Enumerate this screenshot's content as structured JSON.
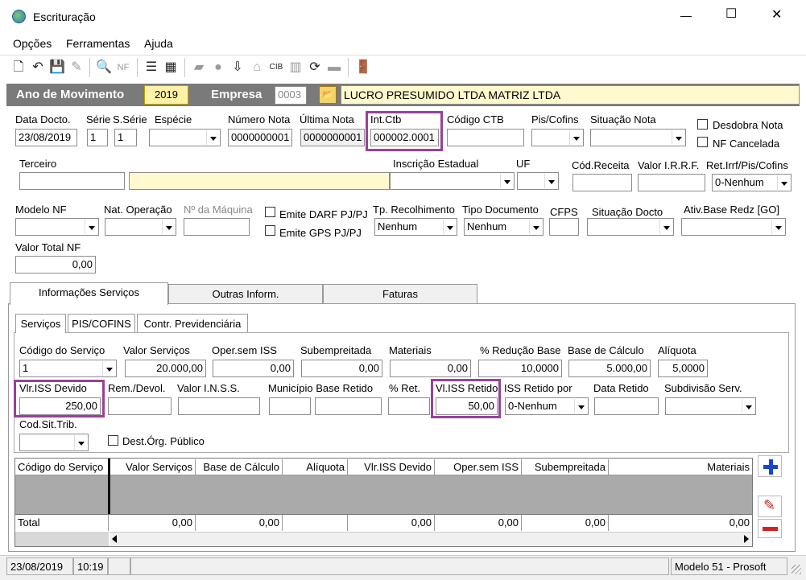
{
  "window": {
    "title": "Escrituração",
    "minimize": "—",
    "maximize": "☐",
    "close": "✕"
  },
  "menu": [
    "Opções",
    "Ferramentas",
    "Ajuda"
  ],
  "header": {
    "ano_label": "Ano de Movimento",
    "ano_value": "2019",
    "empresa_label": "Empresa",
    "empresa_code": "0003",
    "empresa_name": "LUCRO PRESUMIDO LTDA MATRIZ LTDA"
  },
  "row1": {
    "data_docto_label": "Data Docto.",
    "data_docto": "23/08/2019",
    "serie_label": "Série",
    "serie": "1",
    "sserie_label": "S.Série",
    "sserie": "1",
    "especie_label": "Espécie",
    "especie": "",
    "numero_nota_label": "Número Nota",
    "numero_nota": "0000000001",
    "ultima_nota_label": "Última Nota",
    "ultima_nota": "0000000001",
    "int_ctb_label": "Int.Ctb",
    "int_ctb": "000002.0001",
    "codigo_ctb_label": "Código CTB",
    "codigo_ctb": "",
    "pis_cofins_label": "Pis/Cofins",
    "pis_cofins": "",
    "situacao_nota_label": "Situação Nota",
    "situacao_nota": "",
    "desdobra_label": "Desdobra Nota",
    "nf_cancelada_label": "NF Cancelada"
  },
  "row2": {
    "terceiro_label": "Terceiro",
    "terceiro_code": "",
    "terceiro_name": "",
    "insc_estadual_label": "Inscrição Estadual",
    "insc_estadual": "",
    "uf_label": "UF",
    "uf": "",
    "cod_receita_label": "Cód.Receita",
    "cod_receita": "",
    "valor_irrf_label": "Valor I.R.R.F.",
    "valor_irrf": "",
    "ret_irrf_label": "Ret.Irrf/Pis/Cofins",
    "ret_irrf": "0-Nenhum"
  },
  "row3": {
    "modelo_nf_label": "Modelo NF",
    "modelo_nf": "",
    "nat_operacao_label": "Nat. Operação",
    "nat_operacao": "",
    "n_maquina_label": "Nº da Máquina",
    "n_maquina": "",
    "emite_darf_label": "Emite DARF PJ/PJ",
    "emite_gps_label": "Emite GPS PJ/PJ",
    "tp_recolhimento_label": "Tp. Recolhimento",
    "tp_recolhimento": "Nenhum",
    "tipo_documento_label": "Tipo Documento",
    "tipo_documento": "Nenhum",
    "cfps_label": "CFPS",
    "cfps": "",
    "situacao_docto_label": "Situação Docto",
    "situacao_docto": "",
    "ativ_base_label": "Ativ.Base Redz [GO]",
    "ativ_base": ""
  },
  "row4": {
    "valor_total_label": "Valor Total NF",
    "valor_total": "0,00"
  },
  "tabs": [
    "Informações Serviços",
    "Outras Inform.",
    "Faturas"
  ],
  "subtabs": [
    "Serviços",
    "PIS/COFINS",
    "Contr. Previdenciária"
  ],
  "serv1": {
    "codigo_servico_label": "Código do Serviço",
    "codigo_servico": "1",
    "valor_servicos_label": "Valor Serviços",
    "valor_servicos": "20.000,00",
    "oper_sem_iss_label": "Oper.sem ISS",
    "oper_sem_iss": "0,00",
    "subempreitada_label": "Subempreitada",
    "subempreitada": "0,00",
    "materiais_label": "Materiais",
    "materiais": "0,00",
    "reducao_label": "% Redução Base",
    "reducao": "10,0000",
    "base_calculo_label": "Base de Cálculo",
    "base_calculo": "5.000,00",
    "aliquota_label": "Alíquota",
    "aliquota": "5,0000"
  },
  "serv2": {
    "vlr_iss_devido_label": "Vlr.ISS Devido",
    "vlr_iss_devido": "250,00",
    "rem_devol_label": "Rem./Devol.",
    "rem_devol": "",
    "valor_inss_label": "Valor I.N.S.S.",
    "valor_inss": "",
    "municipio_label": "Município Base Retido",
    "municipio_code": "",
    "municipio_name": "",
    "pct_ret_label": "% Ret.",
    "pct_ret": "",
    "vl_iss_retido_label": "Vl.ISS Retido",
    "vl_iss_retido": "50,00",
    "iss_retido_por_label": "ISS Retido por",
    "iss_retido_por": "0-Nenhum",
    "data_retido_label": "Data Retido",
    "data_retido": "",
    "subdivisao_label": "Subdivisão Serv.",
    "subdivisao": ""
  },
  "serv3": {
    "cod_sit_trib_label": "Cod.Sit.Trib.",
    "cod_sit_trib": "",
    "dest_org_label": "Dest.Órg. Público"
  },
  "grid": {
    "columns": [
      "Código do Serviço",
      "Valor Serviços",
      "Base de Cálculo",
      "Alíquota",
      "Vlr.ISS Devido",
      "Oper.sem ISS",
      "Subempreitada",
      "Materiais"
    ],
    "total_label": "Total",
    "totals": [
      "0,00",
      "0,00",
      "",
      "0,00",
      "0,00",
      "0,00",
      "0,00"
    ]
  },
  "status": {
    "date": "23/08/2019",
    "time": "10:19",
    "model": "Modelo 51 - Prosoft"
  }
}
